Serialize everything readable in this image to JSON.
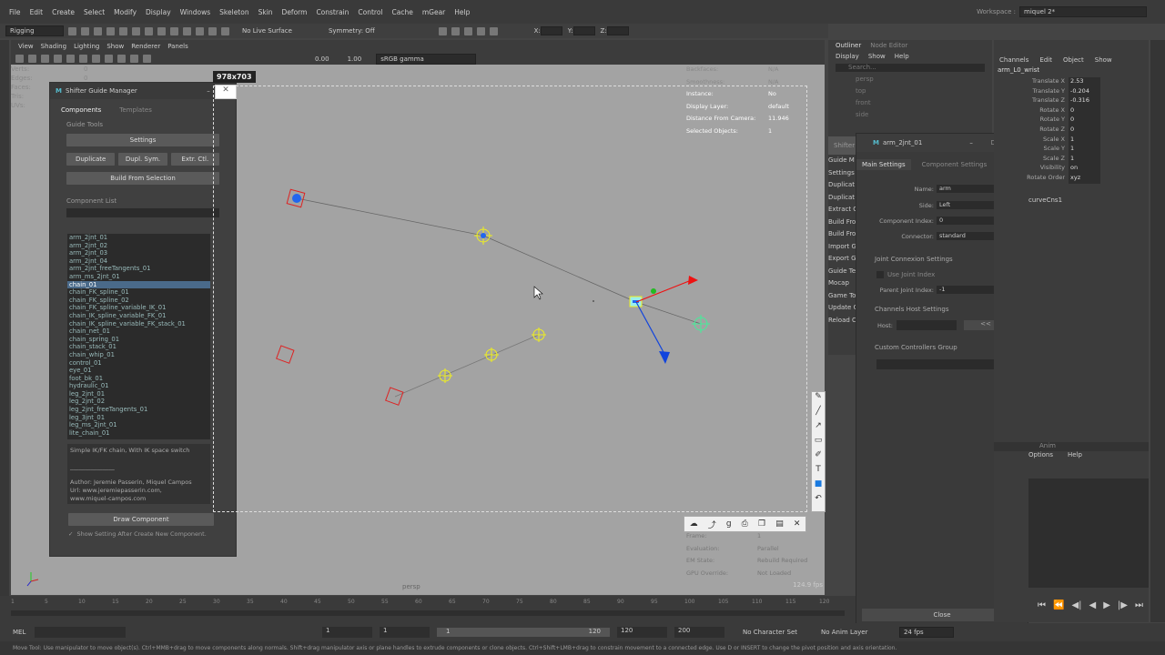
{
  "menu": [
    "File",
    "Edit",
    "Create",
    "Select",
    "Modify",
    "Display",
    "Windows",
    "Skeleton",
    "Skin",
    "Deform",
    "Constrain",
    "Control",
    "Cache",
    "mGear",
    "Help"
  ],
  "workspace": {
    "label": "Workspace :",
    "value": "miquel 2*"
  },
  "shelf": {
    "mode": "Rigging",
    "live_surface": "No Live Surface",
    "symmetry": "Symmetry: Off",
    "x_label": "X:",
    "y_label": "Y:",
    "z_label": "Z:"
  },
  "viewport_menu": [
    "View",
    "Shading",
    "Lighting",
    "Show",
    "Renderer",
    "Panels"
  ],
  "viewport_fields": {
    "v1": "0.00",
    "v2": "1.00",
    "colorspace": "sRGB gamma"
  },
  "hud_left": [
    "Verts:",
    "Edges:",
    "Faces:",
    "Tris:",
    "UVs:"
  ],
  "hud_zeros": [
    "0",
    "0",
    "0",
    "0",
    "0"
  ],
  "snip_dims": "978x703",
  "stats": [
    [
      "Backfaces:",
      "N/A"
    ],
    [
      "Smoothness:",
      "N/A"
    ],
    [
      "Instance:",
      "No"
    ],
    [
      "Display Layer:",
      "default"
    ],
    [
      "Distance From Camera:",
      "11.946"
    ],
    [
      "Selected Objects:",
      "1"
    ]
  ],
  "viewport_label": "persp",
  "sgm": {
    "title": "Shifter Guide Manager",
    "tab1": "Components",
    "tab2": "Templates",
    "guide_tools": "Guide Tools",
    "settings": "Settings",
    "duplicate": "Duplicate",
    "dupl_sym": "Dupl. Sym.",
    "extr_ctl": "Extr. Ctl.",
    "build": "Build From Selection",
    "comp_list": "Component List",
    "draw": "Draw Component",
    "show_setting": "Show Setting After Create New Component."
  },
  "components": [
    "arm_2jnt_01",
    "arm_2jnt_02",
    "arm_2jnt_03",
    "arm_2jnt_04",
    "arm_2jnt_freeTangents_01",
    "arm_ms_2jnt_01",
    "chain_01",
    "chain_FK_spline_01",
    "chain_FK_spline_02",
    "chain_FK_spline_variable_IK_01",
    "chain_IK_spline_variable_FK_01",
    "chain_IK_spline_variable_FK_stack_01",
    "chain_net_01",
    "chain_spring_01",
    "chain_stack_01",
    "chain_whip_01",
    "control_01",
    "eye_01",
    "foot_bk_01",
    "hydraulic_01",
    "leg_2jnt_01",
    "leg_2jnt_02",
    "leg_2jnt_freeTangents_01",
    "leg_3jnt_01",
    "leg_ms_2jnt_01",
    "lite_chain_01"
  ],
  "description": [
    "Simple IK/FK chain, With IK space switch",
    "",
    "_______________",
    "",
    "Author: Jeremie Passerin, Miquel Campos",
    "Url: www.jeremiepasserin.com,",
    "www.miquel-campos.com"
  ],
  "comp_settings": {
    "title": "arm_2jnt_01",
    "tab1": "Main Settings",
    "tab2": "Component Settings",
    "name_lbl": "Name:",
    "name": "arm",
    "side_lbl": "Side:",
    "side": "Left",
    "index_lbl": "Component Index:",
    "index": "0",
    "conn_lbl": "Connector:",
    "conn": "standard",
    "jc": "Joint Connexion Settings",
    "use_joint": "Use Joint Index",
    "parent_lbl": "Parent Joint Index:",
    "parent": "-1",
    "ch_host": "Channels Host Settings",
    "host_lbl": "Host:",
    "host_btn": "<<",
    "custom": "Custom Controllers Group",
    "close": "Close"
  },
  "shifter_side": {
    "title": "Shifter",
    "items": [
      "Guide M",
      "Settings",
      "Duplicat",
      "Duplicat",
      "Extract C",
      "Build Fro",
      "Build Fro",
      "Import G",
      "Export G",
      "Guide Te",
      "Mocap",
      "Game To",
      "Update C",
      "Reload C"
    ]
  },
  "outliner": {
    "tab1": "Outliner",
    "tab2": "Node Editor",
    "menu": [
      "Display",
      "Show",
      "Help"
    ],
    "search": "Search...",
    "items": [
      "persp",
      "top",
      "front",
      "side"
    ]
  },
  "channels": {
    "menu": [
      "Channels",
      "Edit",
      "Object",
      "Show"
    ],
    "object": "arm_L0_wrist",
    "rows": [
      [
        "Translate X",
        "2.53"
      ],
      [
        "Translate Y",
        "-0.204"
      ],
      [
        "Translate Z",
        "-0.316"
      ],
      [
        "Rotate X",
        "0"
      ],
      [
        "Rotate Y",
        "0"
      ],
      [
        "Rotate Z",
        "0"
      ],
      [
        "Scale X",
        "1"
      ],
      [
        "Scale Y",
        "1"
      ],
      [
        "Scale Z",
        "1"
      ],
      [
        "Visibility",
        "on"
      ],
      [
        "Rotate Order",
        "xyz"
      ]
    ],
    "shape": "curveCns1",
    "anim": "Anim",
    "anim_menu": [
      "Options",
      "Help"
    ]
  },
  "vpstat": [
    [
      "Frame:",
      "1"
    ],
    [
      "Evaluation:",
      "Parallel"
    ],
    [
      "EM State:",
      "Rebuild Required"
    ],
    [
      "GPU Override:",
      "Not Loaded"
    ]
  ],
  "fps": "124.9 fps",
  "timeline": {
    "ticks": [
      "1",
      "5",
      "10",
      "15",
      "20",
      "25",
      "30",
      "35",
      "40",
      "45",
      "50",
      "55",
      "60",
      "65",
      "70",
      "75",
      "80",
      "85",
      "90",
      "95",
      "100",
      "105",
      "110",
      "115",
      "120"
    ]
  },
  "cmd": {
    "mel": "MEL",
    "start": "1",
    "start2": "1",
    "range_start": "1",
    "range_end": "120",
    "end": "120",
    "end2": "200",
    "char": "No Character Set",
    "anim_layer": "No Anim Layer",
    "fps": "24 fps"
  },
  "help": "Move Tool: Use manipulator to move object(s). Ctrl+MMB+drag to move components along normals. Shift+drag manipulator axis or plane handles to extrude components or clone objects. Ctrl+Shift+LMB+drag to constrain movement to a connected edge. Use D or INSERT to change the pivot position and axis orientation."
}
